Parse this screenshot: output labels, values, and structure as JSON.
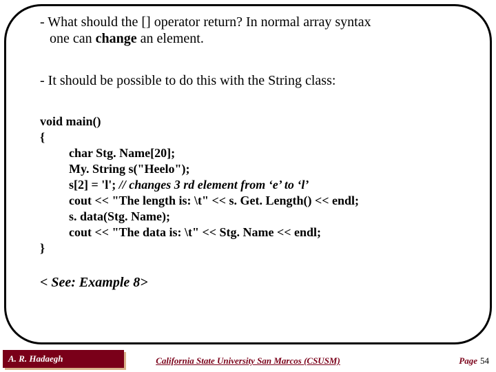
{
  "para1_line1": "- What should the [] operator return? In normal array syntax",
  "para1_line2_pre": "one can ",
  "para1_line2_bold": "change",
  "para1_line2_post": " an element.",
  "para2": "- It should be possible to do this with the String class:",
  "code": {
    "l1": "void main()",
    "l2": "{",
    "l3": "char Stg. Name[20];",
    "l4": "My. String    s(\"Heelo\");",
    "l5a": "s[2] = 'l';      ",
    "l5b": "// changes 3 rd element from ‘e’ to ‘l’",
    "l6": "cout << \"The length is: \\t\" << s. Get. Length() << endl;",
    "l7": "s. data(Stg. Name);",
    "l8": "cout << \"The data is: \\t\" << Stg. Name << endl;",
    "l9": "}"
  },
  "see": "< See: Example 8>",
  "footer": {
    "author": "A. R. Hadaegh",
    "org": "California State University San Marcos (CSUSM)",
    "page_label": "Page",
    "page_num": "54"
  }
}
